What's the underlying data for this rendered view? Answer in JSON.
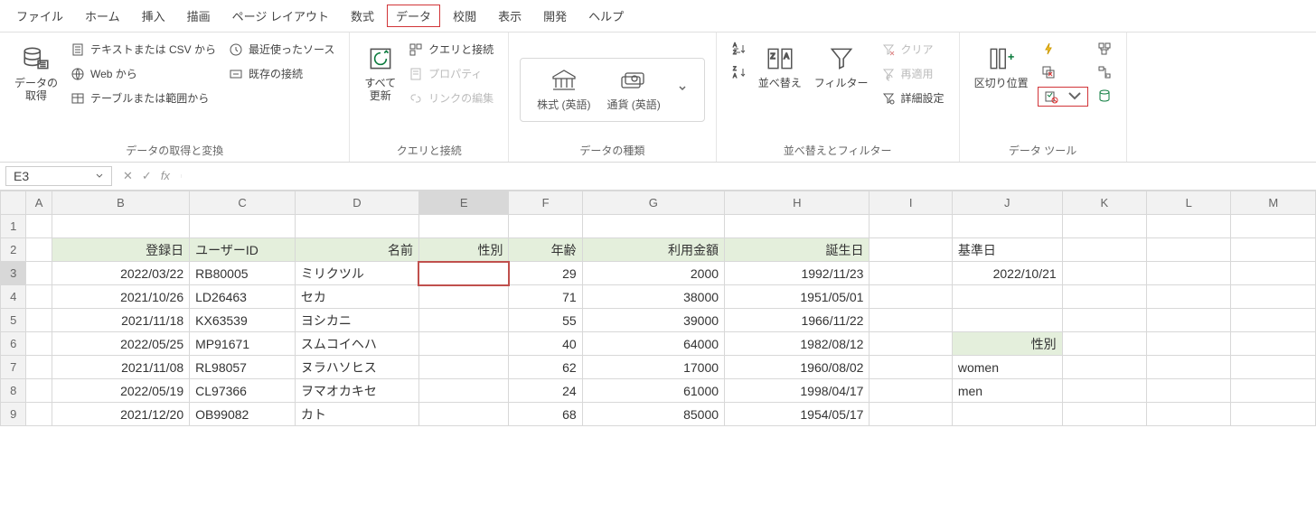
{
  "menu": {
    "file": "ファイル",
    "home": "ホーム",
    "insert": "挿入",
    "draw": "描画",
    "page_layout": "ページ レイアウト",
    "formulas": "数式",
    "data": "データ",
    "review": "校閲",
    "view": "表示",
    "developer": "開発",
    "help": "ヘルプ"
  },
  "ribbon": {
    "get_transform": {
      "get_data": "データの\n取得",
      "from_csv": "テキストまたは CSV から",
      "from_web": "Web から",
      "from_table": "テーブルまたは範囲から",
      "recent": "最近使ったソース",
      "existing": "既存の接続",
      "label": "データの取得と変換"
    },
    "queries": {
      "refresh": "すべて\n更新",
      "conn": "クエリと接続",
      "prop": "プロパティ",
      "links": "リンクの編集",
      "label": "クエリと接続"
    },
    "types": {
      "stocks": "株式 (英語)",
      "currency": "通貨 (英語)",
      "label": "データの種類"
    },
    "sort": {
      "sort": "並べ替え",
      "filter": "フィルター",
      "clear": "クリア",
      "reapply": "再適用",
      "advanced": "詳細設定",
      "label": "並べ替えとフィルター"
    },
    "tools": {
      "text_to_col": "区切り位置",
      "label": "データ ツール"
    }
  },
  "namebox": "E3",
  "columns": [
    "A",
    "B",
    "C",
    "D",
    "E",
    "F",
    "G",
    "H",
    "I",
    "J",
    "K",
    "L",
    "M"
  ],
  "col_widths": {
    "A": 28,
    "B": 150,
    "C": 115,
    "D": 135,
    "E": 98,
    "F": 80,
    "G": 155,
    "H": 158,
    "I": 90,
    "J": 120,
    "K": 92,
    "L": 92,
    "M": 92
  },
  "headers": {
    "B": "登録日",
    "C": "ユーザーID",
    "D": "名前",
    "E": "性別",
    "F": "年齢",
    "G": "利用金額",
    "H": "誕生日",
    "J_r2": "基準日",
    "J_r6": "性別"
  },
  "rows": [
    {
      "n": 1
    },
    {
      "n": 2
    },
    {
      "n": 3,
      "B": "2022/03/22",
      "C": "RB80005",
      "D": "ミリクツル",
      "F": "29",
      "G": "2000",
      "H": "1992/11/23",
      "J": "2022/10/21"
    },
    {
      "n": 4,
      "B": "2021/10/26",
      "C": "LD26463",
      "D": "セカ",
      "F": "71",
      "G": "38000",
      "H": "1951/05/01"
    },
    {
      "n": 5,
      "B": "2021/11/18",
      "C": "KX63539",
      "D": "ヨシカニ",
      "F": "55",
      "G": "39000",
      "H": "1966/11/22"
    },
    {
      "n": 6,
      "B": "2022/05/25",
      "C": "MP91671",
      "D": "スムコイヘハ",
      "F": "40",
      "G": "64000",
      "H": "1982/08/12"
    },
    {
      "n": 7,
      "B": "2021/11/08",
      "C": "RL98057",
      "D": "ヌラハソヒス",
      "F": "62",
      "G": "17000",
      "H": "1960/08/02",
      "J": "women"
    },
    {
      "n": 8,
      "B": "2022/05/19",
      "C": "CL97366",
      "D": "ヲマオカキセ",
      "F": "24",
      "G": "61000",
      "H": "1998/04/17",
      "J": "men"
    },
    {
      "n": 9,
      "B": "2021/12/20",
      "C": "OB99082",
      "D": "カト",
      "F": "68",
      "G": "85000",
      "H": "1954/05/17"
    }
  ],
  "selected_cell": "E3",
  "highlighted_menu": "data",
  "highlighted_ribbon_button": "data-validation"
}
